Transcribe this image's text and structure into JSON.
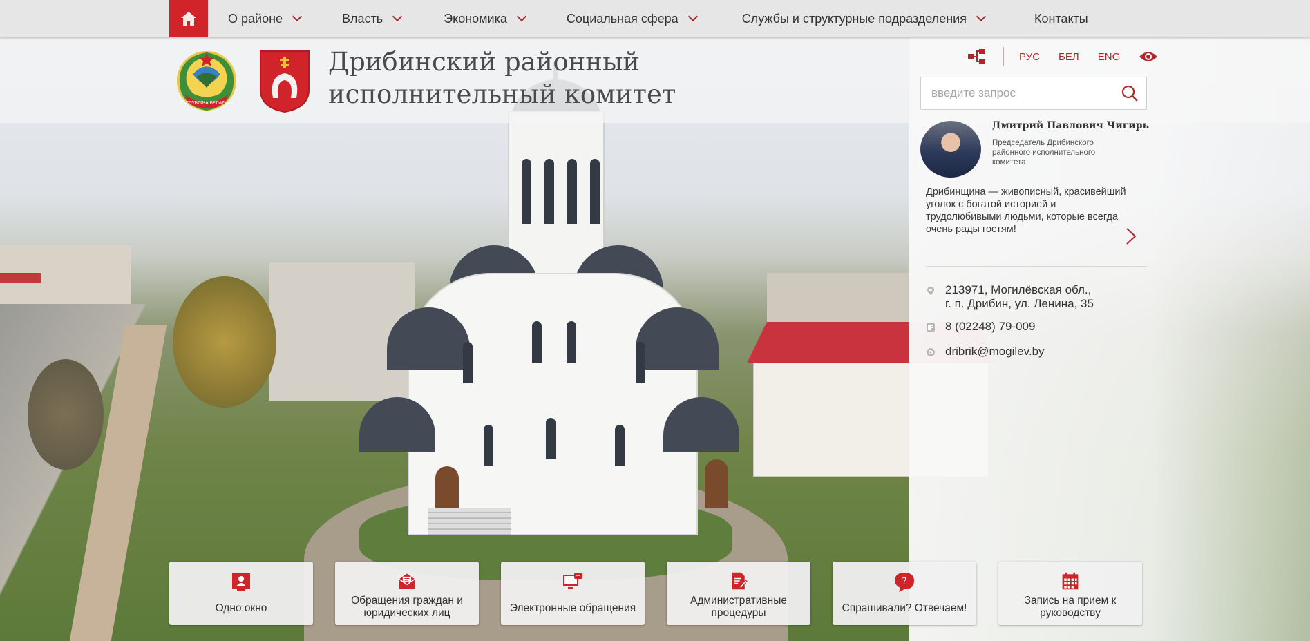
{
  "nav": {
    "items": [
      {
        "label": "О районе",
        "dropdown": true
      },
      {
        "label": "Власть",
        "dropdown": true
      },
      {
        "label": "Экономика",
        "dropdown": true
      },
      {
        "label": "Социальная сфера",
        "dropdown": true
      },
      {
        "label": "Службы и структурные подразделения",
        "dropdown": true
      },
      {
        "label": "Контакты",
        "dropdown": false
      }
    ]
  },
  "header": {
    "title_line1": "Дрибинский районный",
    "title_line2": "исполнительный комитет",
    "emblem_text": "РЭСПУБЛІКА БЕЛАРУСЬ"
  },
  "languages": [
    "РУС",
    "БЕЛ",
    "ENG"
  ],
  "search": {
    "placeholder": "введите запрос",
    "value": ""
  },
  "chairman": {
    "name": "Дмитрий Павлович Чигирь",
    "role": "Председатель Дрибинского районного исполнительного комитета"
  },
  "quote": "Дрибинщина — живописный, красивейший уголок с богатой историей и трудолюбивыми людьми, которые всегда очень рады гостям!",
  "contacts": {
    "address_line1": "213971, Могилёвская обл.,",
    "address_line2": "г. п. Дрибин, ул. Ленина, 35",
    "phone": "8 (02248) 79-009",
    "email": "dribrik@mogilev.by"
  },
  "tiles": [
    {
      "label": "Одно окно",
      "icon": "one-window-icon"
    },
    {
      "label": "Обращения граждан и юридических лиц",
      "icon": "letter-icon"
    },
    {
      "label": "Электронные обращения",
      "icon": "computer-icon"
    },
    {
      "label": "Административные процедуры",
      "icon": "document-pen-icon"
    },
    {
      "label": "Спрашивали? Отвечаем!",
      "icon": "question-bubble-icon"
    },
    {
      "label": "Запись на прием к руководству",
      "icon": "calendar-icon"
    }
  ],
  "colors": {
    "accent": "#d0232a",
    "accent_dark": "#b0262b",
    "nav_bg": "#e6e6e6"
  }
}
